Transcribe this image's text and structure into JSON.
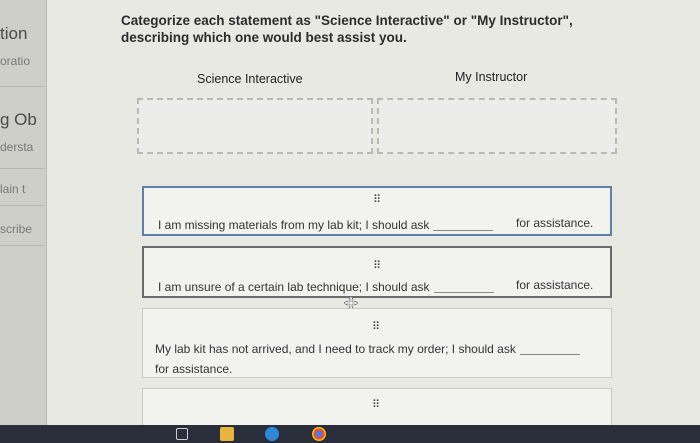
{
  "sidebar": {
    "items": [
      {
        "label": "tion"
      },
      {
        "label": "oratio"
      },
      {
        "label": "g Ob"
      },
      {
        "label": "dersta"
      },
      {
        "label": "lain t"
      },
      {
        "label": "scribe"
      }
    ]
  },
  "main": {
    "instruction": "Categorize each statement as \"Science Interactive\" or \"My Instructor\", describing which one would best assist you.",
    "columns": [
      {
        "label": "Science Interactive"
      },
      {
        "label": "My Instructor"
      }
    ],
    "cards": [
      {
        "text": "I am missing materials from my lab kit; I should ask",
        "suffix": "for assistance."
      },
      {
        "text": "I am unsure of a certain lab technique; I should ask",
        "suffix": "for assistance."
      },
      {
        "text": "My lab kit has not arrived, and I need to track my order; I should ask",
        "suffix": "for assistance."
      }
    ],
    "grip_glyph": "⠿"
  },
  "taskbar": {
    "icons": [
      "file-explorer-icon",
      "folder-icon",
      "edge-icon",
      "chrome-icon"
    ]
  }
}
